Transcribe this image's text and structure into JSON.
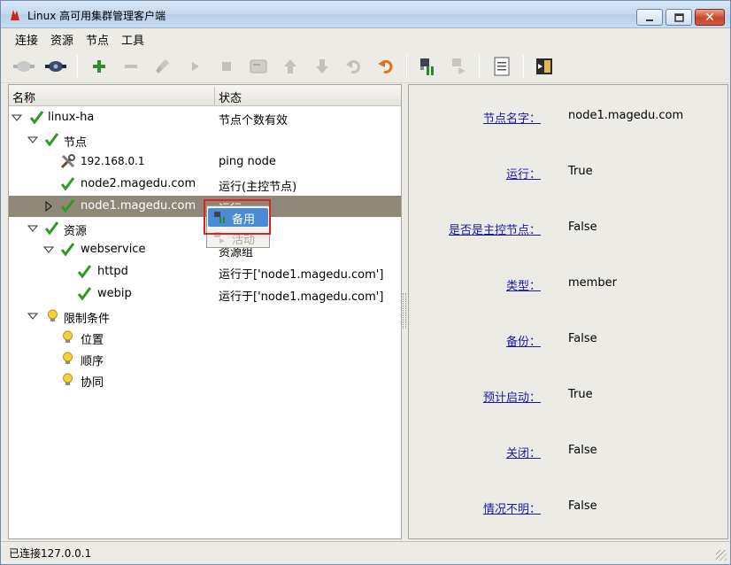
{
  "window": {
    "title": "Linux 高可用集群管理客户端"
  },
  "menu": {
    "items": [
      "连接",
      "资源",
      "节点",
      "工具"
    ]
  },
  "tree": {
    "headers": {
      "name": "名称",
      "status": "状态"
    },
    "rows": [
      {
        "name": "linux-ha",
        "status": "节点个数有效",
        "icon": "check-icon"
      },
      {
        "name": "节点",
        "status": "",
        "icon": "check-icon"
      },
      {
        "name": "192.168.0.1",
        "status": "ping node",
        "icon": "tools-icon"
      },
      {
        "name": "node2.magedu.com",
        "status": "运行(主控节点)",
        "icon": "check-icon"
      },
      {
        "name": "node1.magedu.com",
        "status": "运行",
        "icon": "check-icon"
      },
      {
        "name": "资源",
        "status": "",
        "icon": "check-icon"
      },
      {
        "name": "webservice",
        "status": "资源组",
        "icon": "check-icon"
      },
      {
        "name": "httpd",
        "status": "运行于['node1.magedu.com']",
        "icon": "check-icon"
      },
      {
        "name": "webip",
        "status": "运行于['node1.magedu.com']",
        "icon": "check-icon"
      },
      {
        "name": "限制条件",
        "status": "",
        "icon": "bulb-icon"
      },
      {
        "name": "位置",
        "status": "",
        "icon": "bulb-icon"
      },
      {
        "name": "顺序",
        "status": "",
        "icon": "bulb-icon"
      },
      {
        "name": "协同",
        "status": "",
        "icon": "bulb-icon"
      }
    ]
  },
  "context_menu": {
    "items": [
      {
        "label": "备用"
      },
      {
        "label": "活动"
      }
    ]
  },
  "properties": [
    {
      "label": "节点名字：",
      "value": "node1.magedu.com"
    },
    {
      "label": "运行：",
      "value": "True"
    },
    {
      "label": "是否是主控节点：",
      "value": "False"
    },
    {
      "label": "类型：",
      "value": "member"
    },
    {
      "label": "备份：",
      "value": "False"
    },
    {
      "label": "预计启动：",
      "value": "True"
    },
    {
      "label": "关闭：",
      "value": "False"
    },
    {
      "label": "情况不明：",
      "value": "False"
    }
  ],
  "statusbar": {
    "text": "已连接127.0.0.1"
  },
  "colors": {
    "selection": "#8f8878",
    "menu_highlight": "#4a8bd6",
    "link": "#1a1aa8",
    "callout": "#e3221c",
    "check": "#2d9a22"
  }
}
